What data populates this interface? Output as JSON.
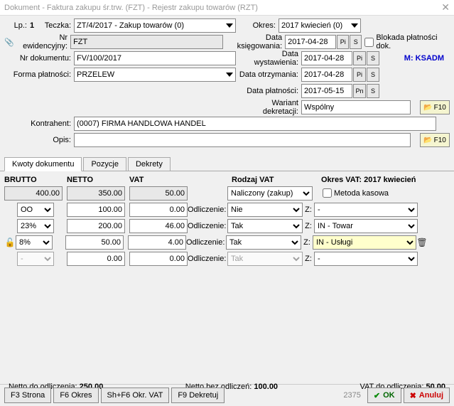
{
  "titlebar": {
    "title": "Dokument - Faktura zakupu śr.trw. (FZT) - Rejestr zakupu towarów (RZT)"
  },
  "header": {
    "lp_label": "Lp.:",
    "lp_value": "1",
    "teczka_label": "Teczka:",
    "teczka_value": "ZT/4/2017 - Zakup towarów (0)",
    "okres_label": "Okres:",
    "okres_value": "2017 kwiecień (0)",
    "nr_ewid_label": "Nr ewidencyjny:",
    "nr_ewid_value": "FZT",
    "data_ksieg_label": "Data księgowania:",
    "data_ksieg_value": "2017-04-28",
    "blokada_label": "Blokada płatności dok.",
    "nr_dok_label": "Nr dokumentu:",
    "nr_dok_value": "FV/100/2017",
    "data_wyst_label": "Data wystawienia:",
    "data_wyst_value": "2017-04-28",
    "user_label": "M: KSADM",
    "forma_label": "Forma płatności:",
    "forma_value": "PRZELEW",
    "data_otrzym_label": "Data otrzymania:",
    "data_otrzym_value": "2017-04-28",
    "data_plat_label": "Data płatności:",
    "data_plat_value": "2017-05-15",
    "wariant_label": "Wariant dekretacji:",
    "wariant_value": "Wspólny",
    "kontrahent_label": "Kontrahent:",
    "kontrahent_value": "(0007) FIRMA HANDLOWA HANDEL",
    "opis_label": "Opis:",
    "opis_value": "",
    "pi": "Pi",
    "pn": "Pn",
    "s_btn": "S",
    "f10_btn": "F10"
  },
  "tabs": {
    "kwoty": "Kwoty dokumentu",
    "pozycje": "Pozycje",
    "dekrety": "Dekrety"
  },
  "grid": {
    "h_brutto": "BRUTTO",
    "h_netto": "NETTO",
    "h_vat": "VAT",
    "h_rodzaj": "Rodzaj VAT",
    "okres_vat_label": "Okres VAT:",
    "okres_vat_value": "2017 kwiecień",
    "rodzaj_value": "Naliczony (zakup)",
    "metoda_label": "Metoda kasowa",
    "totals": {
      "brutto": "400.00",
      "netto": "350.00",
      "vat": "50.00"
    },
    "odliczenie_label": "Odliczenie:",
    "z_label": "Z:",
    "rows": [
      {
        "rate": "OO",
        "netto": "100.00",
        "vat": "0.00",
        "odl": "Nie",
        "z": "-"
      },
      {
        "rate": "23%",
        "netto": "200.00",
        "vat": "46.00",
        "odl": "Tak",
        "z": "IN - Towar"
      },
      {
        "rate": "8%",
        "netto": "50.00",
        "vat": "4.00",
        "odl": "Tak",
        "z": "IN - Usługi"
      },
      {
        "rate": "-",
        "netto": "0.00",
        "vat": "0.00",
        "odl": "Tak",
        "z": "-"
      }
    ]
  },
  "summary": {
    "netto_odl": "Netto do odliczenia: ",
    "netto_odl_val": "250.00",
    "netto_bez": "Netto bez odliczeń: ",
    "netto_bez_val": "100.00",
    "vat_odl": "VAT do odliczenia: ",
    "vat_odl_val": "50.00"
  },
  "footer": {
    "f3": "F3 Strona",
    "f6": "F6 Okres",
    "shf6": "Sh+F6 Okr. VAT",
    "f9": "F9 Dekretuj",
    "recno": "2375",
    "ok": "OK",
    "anuluj": "Anuluj"
  }
}
